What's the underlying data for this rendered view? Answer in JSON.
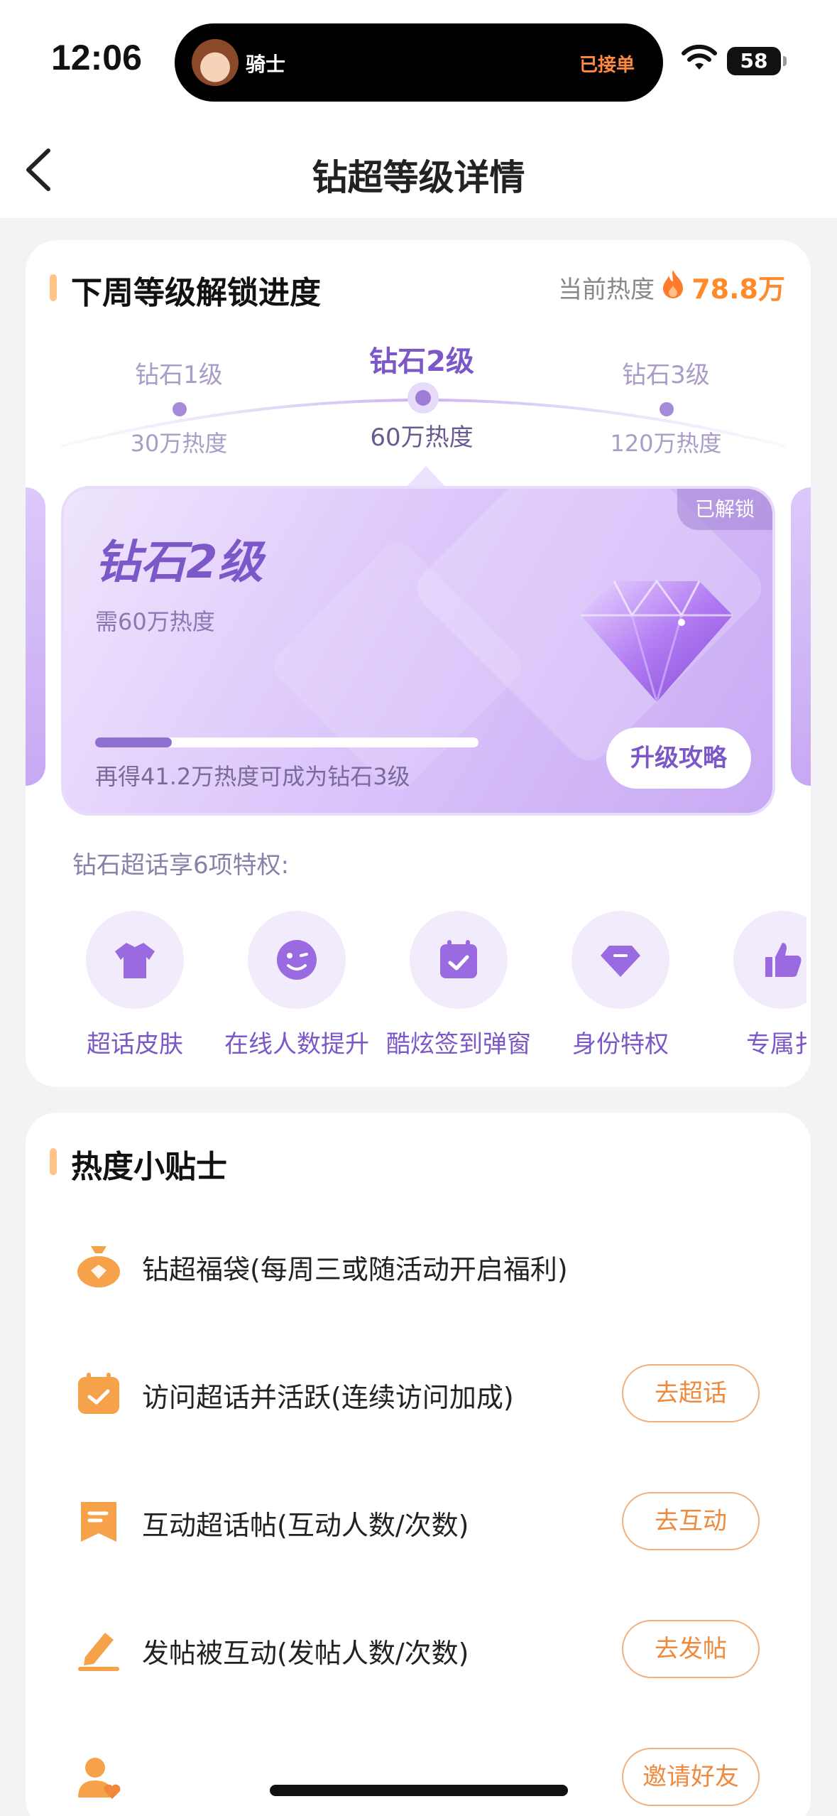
{
  "status_bar": {
    "time": "12:06",
    "activity_name": "骑士",
    "activity_status": "已接单",
    "battery": "58"
  },
  "nav": {
    "title": "钻超等级详情"
  },
  "progress_section": {
    "title": "下周等级解锁进度",
    "current_heat_label": "当前热度",
    "current_heat_value": "78.8万",
    "levels": [
      {
        "name": "钻石1级",
        "heat": "30万热度"
      },
      {
        "name": "钻石2级",
        "heat": "60万热度"
      },
      {
        "name": "钻石3级",
        "heat": "120万热度"
      }
    ],
    "active_level": 1,
    "level_card": {
      "badge": "已解锁",
      "name": "钻石2级",
      "requirement": "需60万热度",
      "progress_fraction": 0.2,
      "progress_text": "再得41.2万热度可成为钻石3级",
      "upgrade_button": "升级攻略"
    },
    "privileges_title": "钻石超话享6项特权:",
    "privileges": [
      {
        "label": "超话皮肤",
        "icon": "shirt-icon"
      },
      {
        "label": "在线人数提升",
        "icon": "smile-wink-icon"
      },
      {
        "label": "酷炫签到弹窗",
        "icon": "calendar-check-icon"
      },
      {
        "label": "身份特权",
        "icon": "gem-badge-icon"
      },
      {
        "label": "专属扌",
        "icon": "thumbs-up-icon"
      }
    ]
  },
  "tips_section": {
    "title": "热度小贴士",
    "tips": [
      {
        "text": "钻超福袋(每周三或随活动开启福利)",
        "button": "",
        "icon": "lucky-bag-icon"
      },
      {
        "text": "访问超话并活跃(连续访问加成)",
        "button": "去超话",
        "icon": "calendar-icon"
      },
      {
        "text": "互动超话帖(互动人数/次数)",
        "button": "去互动",
        "icon": "bookmark-icon"
      },
      {
        "text": "发帖被互动(发帖人数/次数)",
        "button": "去发帖",
        "icon": "pencil-icon"
      },
      {
        "text": "",
        "button": "邀请好友",
        "icon": "user-heart-icon"
      }
    ]
  },
  "colors": {
    "accent_purple": "#7b57c8",
    "accent_orange": "#ff8a2a",
    "background": "#f3f3f5"
  }
}
